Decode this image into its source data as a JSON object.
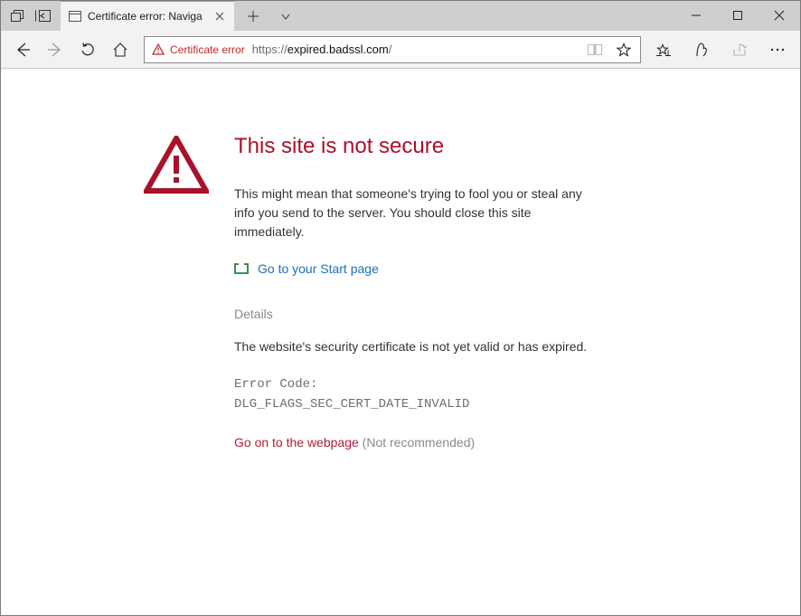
{
  "tab": {
    "title": "Certificate error: Naviga"
  },
  "addressbar": {
    "security_label": "Certificate error",
    "url_proto": "https://",
    "url_host": "expired.badssl.com",
    "url_path": "/"
  },
  "page": {
    "heading": "This site is not secure",
    "description": "This might mean that someone's trying to fool you or steal any info you send to the server. You should close this site immediately.",
    "start_link": "Go to your Start page",
    "details_heading": "Details",
    "details_text": "The website's security certificate is not yet valid or has expired.",
    "error_label": "Error Code:",
    "error_code": "DLG_FLAGS_SEC_CERT_DATE_INVALID",
    "continue_link": "Go on to the webpage",
    "continue_note": "(Not recommended)"
  }
}
